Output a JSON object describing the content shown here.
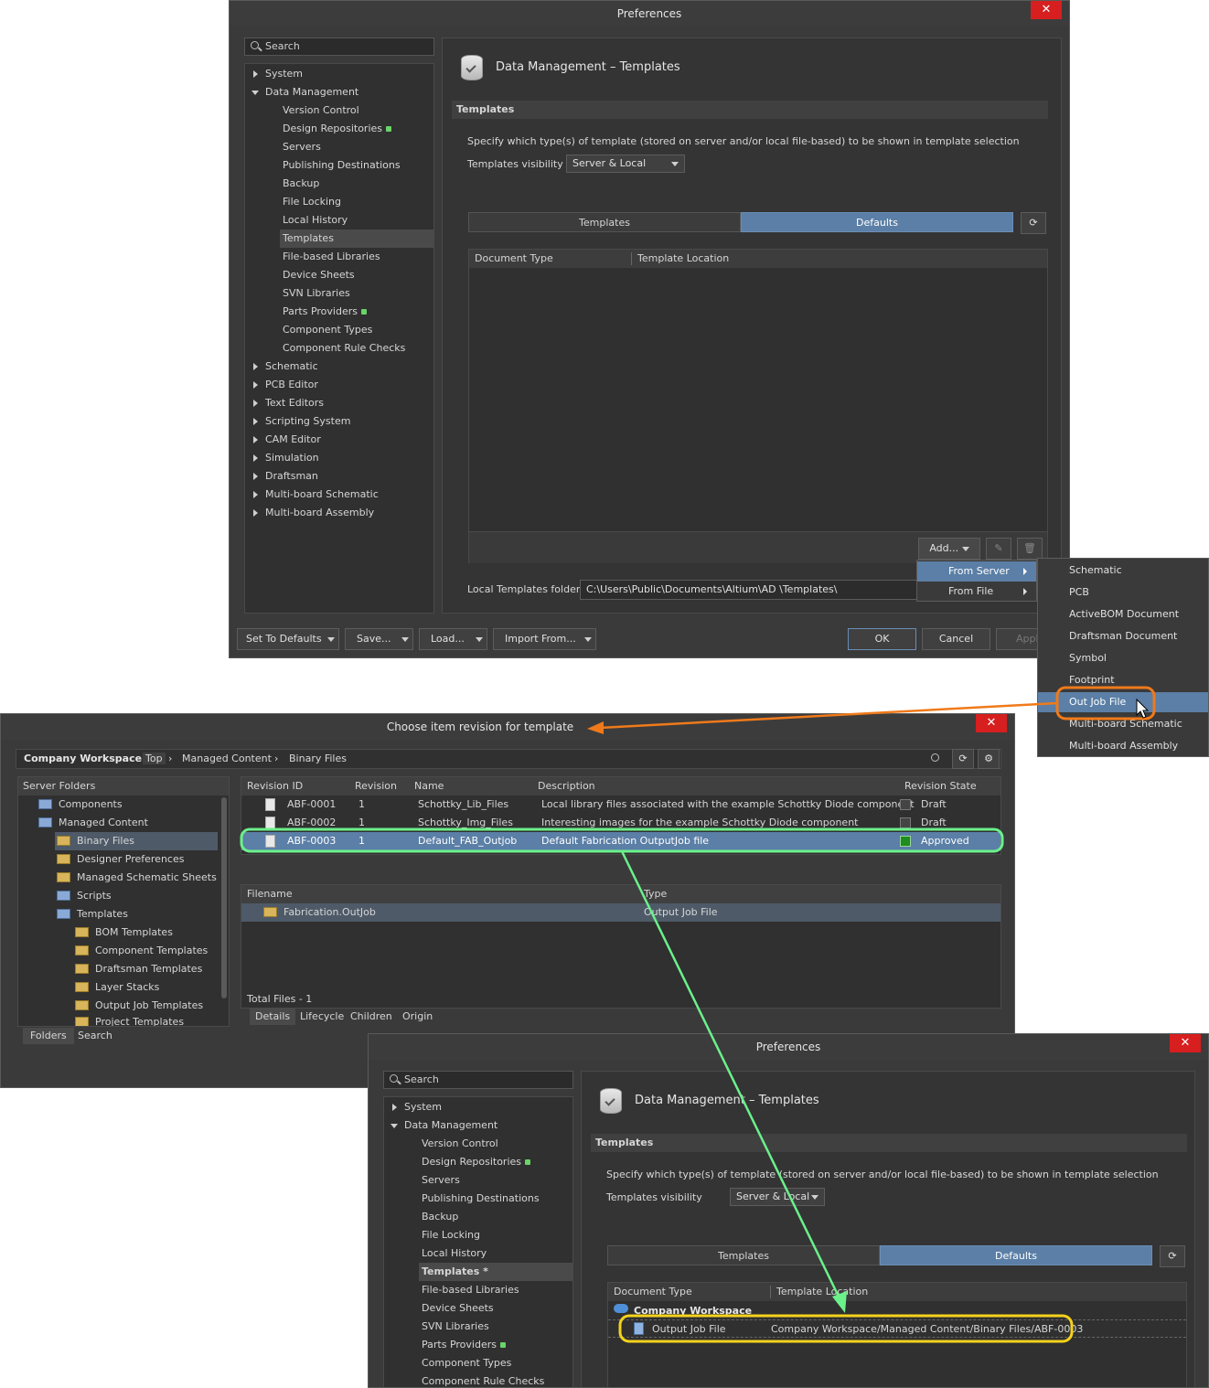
{
  "pref1": {
    "title": "Preferences",
    "close": "✕",
    "search_placeholder": "Search",
    "tree": [
      "System",
      "Data Management",
      "Version Control",
      "Design Repositories",
      "Servers",
      "Publishing Destinations",
      "Backup",
      "File Locking",
      "Local History",
      "Templates",
      "File-based Libraries",
      "Device Sheets",
      "SVN Libraries",
      "Parts Providers",
      "Component Types",
      "Component Rule Checks",
      "Schematic",
      "PCB Editor",
      "Text Editors",
      "Scripting System",
      "CAM Editor",
      "Simulation",
      "Draftsman",
      "Multi-board Schematic",
      "Multi-board Assembly"
    ],
    "page_title": "Data Management – Templates",
    "section": "Templates",
    "desc": "Specify which type(s) of template (stored on server and/or local file-based) to be shown in template selection",
    "vis_label": "Templates visibility",
    "vis_value": "Server & Local",
    "tab_templates": "Templates",
    "tab_defaults": "Defaults",
    "col_doc": "Document Type",
    "col_loc": "Template Location",
    "add": "Add...",
    "local_label": "Local Templates folder",
    "local_path": "C:\\Users\\Public\\Documents\\Altium\\AD   \\Templates\\",
    "set_defaults": "Set To Defaults",
    "save": "Save...",
    "load": "Load...",
    "import": "Import From...",
    "ok": "OK",
    "cancel": "Cancel",
    "apply": "Apply"
  },
  "add_menu": {
    "from_server": "From Server",
    "from_file": "From File"
  },
  "sub_menu": [
    "Schematic",
    "PCB",
    "ActiveBOM Document",
    "Draftsman Document",
    "Symbol",
    "Footprint",
    "Out Job File",
    "Multi-board Schematic",
    "Multi-board Assembly"
  ],
  "chooser": {
    "title": "Choose item revision for template",
    "close": "✕",
    "workspace": "Company Workspace",
    "crumbs": [
      "Top",
      "Managed Content",
      "Binary Files"
    ],
    "folders_header": "Server Folders",
    "folders": [
      "Components",
      "Managed Content",
      "Binary Files",
      "Designer Preferences",
      "Managed Schematic Sheets",
      "Scripts",
      "Templates",
      "BOM Templates",
      "Component Templates",
      "Draftsman Templates",
      "Layer Stacks",
      "Output Job Templates",
      "Project Templates"
    ],
    "bottom_tabs": [
      "Folders",
      "Search"
    ],
    "cols": [
      "Revision ID",
      "Revision",
      "Name",
      "Description",
      "Revision State"
    ],
    "rows": [
      {
        "id": "ABF-0001",
        "rev": "1",
        "name": "Schottky_Lib_Files",
        "desc": "Local library files associated with the example Schottky Diode component",
        "state": "Draft",
        "color": "#444444"
      },
      {
        "id": "ABF-0002",
        "rev": "1",
        "name": "Schottky_Img_Files",
        "desc": "Interesting images for the example Schottky Diode component",
        "state": "Draft",
        "color": "#444444"
      },
      {
        "id": "ABF-0003",
        "rev": "1",
        "name": "Default_FAB_Outjob",
        "desc": "Default Fabrication OutputJob file",
        "state": "Approved",
        "color": "#1e8c1e"
      }
    ],
    "file_cols": [
      "Filename",
      "Type"
    ],
    "file": {
      "name": "Fabrication.OutJob",
      "type": "Output Job File"
    },
    "total": "Total Files - 1",
    "detail_tabs": [
      "Details",
      "Lifecycle",
      "Children",
      "Origin"
    ]
  },
  "pref2": {
    "title": "Preferences",
    "close": "✕",
    "search_placeholder": "Search",
    "tree": [
      "System",
      "Data Management",
      "Version Control",
      "Design Repositories",
      "Servers",
      "Publishing Destinations",
      "Backup",
      "File Locking",
      "Local History",
      "Templates *",
      "File-based Libraries",
      "Device Sheets",
      "SVN Libraries",
      "Parts Providers",
      "Component Types",
      "Component Rule Checks"
    ],
    "page_title": "Data Management – Templates",
    "section": "Templates",
    "desc": "Specify which type(s) of template (stored on server and/or local file-based) to be shown in template selection",
    "vis_label": "Templates visibility",
    "vis_value": "Server & Local",
    "tab_templates": "Templates",
    "tab_defaults": "Defaults",
    "col_doc": "Document Type",
    "col_loc": "Template Location",
    "group": "Company Workspace",
    "entry_doc": "Output Job File",
    "entry_loc": "Company Workspace/Managed Content/Binary Files/ABF-0003"
  },
  "colors": {
    "orange": "#f07a1a",
    "green": "#6bf08a",
    "yellow": "#f5d21c",
    "accent": "#5b7fa6"
  }
}
